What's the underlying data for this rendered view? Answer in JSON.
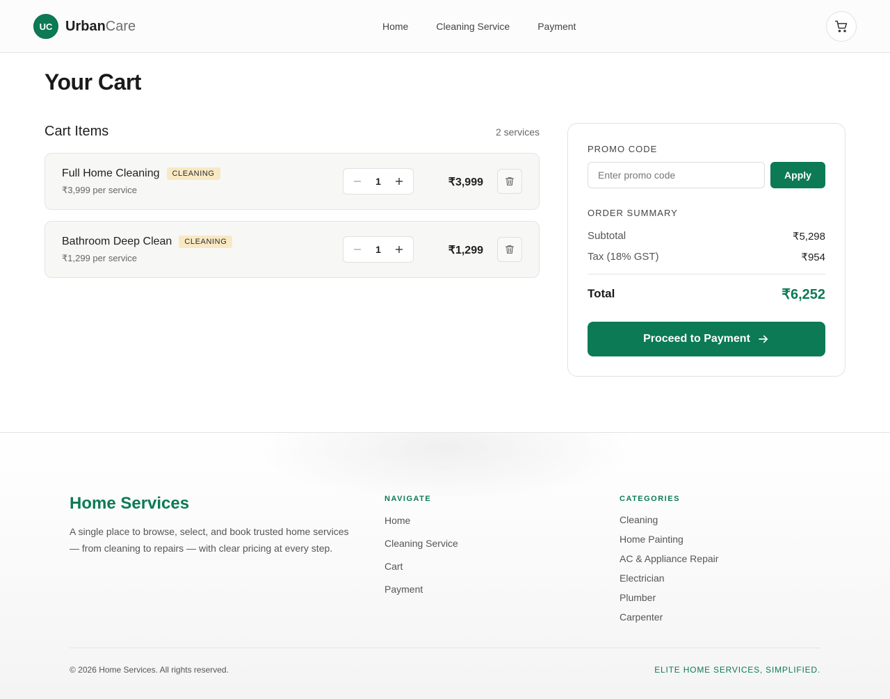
{
  "header": {
    "logo_initials": "UC",
    "logo_bold": "Urban",
    "logo_light": "Care",
    "nav": [
      "Home",
      "Cleaning Service",
      "Payment"
    ]
  },
  "main": {
    "title": "Your Cart",
    "items_title": "Cart Items",
    "items_count": "2 services",
    "items": [
      {
        "name": "Full Home Cleaning",
        "tag": "CLEANING",
        "unit_price": "₹3,999 per service",
        "quantity": "1",
        "price": "₹3,999"
      },
      {
        "name": "Bathroom Deep Clean",
        "tag": "CLEANING",
        "unit_price": "₹1,299 per service",
        "quantity": "1",
        "price": "₹1,299"
      }
    ]
  },
  "summary": {
    "promo_label": "PROMO CODE",
    "promo_placeholder": "Enter promo code",
    "apply_label": "Apply",
    "order_label": "ORDER SUMMARY",
    "subtotal_label": "Subtotal",
    "subtotal_value": "₹5,298",
    "tax_label": "Tax (18% GST)",
    "tax_value": "₹954",
    "total_label": "Total",
    "total_value": "₹6,252",
    "pay_label": "Proceed to Payment"
  },
  "footer": {
    "title": "Home Services",
    "description": "A single place to browse, select, and book trusted home services — from cleaning to repairs — with clear pricing at every step.",
    "navigate_heading": "NAVIGATE",
    "navigate_links": [
      "Home",
      "Cleaning Service",
      "Cart",
      "Payment"
    ],
    "categories_heading": "CATEGORIES",
    "categories_links": [
      "Cleaning",
      "Home Painting",
      "AC & Appliance Repair",
      "Electrician",
      "Plumber",
      "Carpenter"
    ],
    "copyright": "© 2026 Home Services. All rights reserved.",
    "tagline": "ELITE HOME SERVICES, SIMPLIFIED."
  },
  "colors": {
    "brand": "#0b7a55",
    "tag_bg": "#f8e9c4"
  },
  "icons": {
    "cart": "cart-icon",
    "minus": "minus-icon",
    "plus": "plus-icon",
    "trash": "trash-icon",
    "arrow": "arrow-right-icon"
  }
}
